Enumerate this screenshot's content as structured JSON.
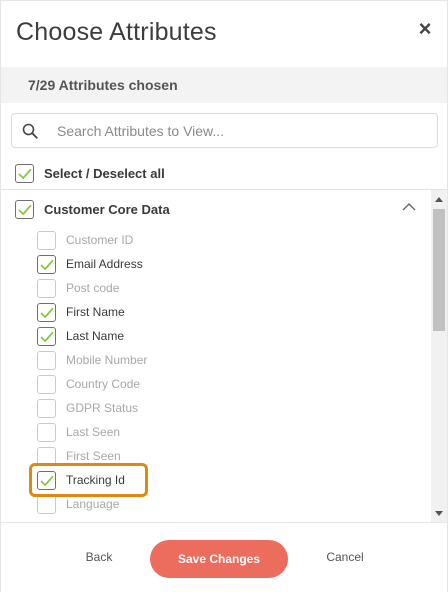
{
  "header": {
    "title": "Choose Attributes",
    "close_symbol": "×"
  },
  "summary": {
    "chosen_text": "7/29 Attributes chosen"
  },
  "search": {
    "placeholder": "Search Attributes to View...",
    "value": ""
  },
  "select_all": {
    "label": "Select / Deselect all",
    "checked": true
  },
  "groups": [
    {
      "label": "Customer Core Data",
      "checked": true,
      "expanded": true,
      "attributes": [
        {
          "label": "Customer ID",
          "checked": false
        },
        {
          "label": "Email Address",
          "checked": true
        },
        {
          "label": "Post code",
          "checked": false
        },
        {
          "label": "First Name",
          "checked": true
        },
        {
          "label": "Last Name",
          "checked": true
        },
        {
          "label": "Mobile Number",
          "checked": false
        },
        {
          "label": "Country Code",
          "checked": false
        },
        {
          "label": "GDPR Status",
          "checked": false
        },
        {
          "label": "Last Seen",
          "checked": false
        },
        {
          "label": "First Seen",
          "checked": false
        },
        {
          "label": "Tracking Id",
          "checked": true
        },
        {
          "label": "Language",
          "checked": false
        }
      ]
    }
  ],
  "footer": {
    "back_label": "Back",
    "save_label": "Save Changes",
    "cancel_label": "Cancel"
  },
  "colors": {
    "check": "#8cc63f",
    "save_button": "#ec6c5d",
    "highlight": "#dd8a12"
  },
  "icons": {
    "search": "search-icon",
    "close": "close-icon",
    "collapse": "chevron-up-icon",
    "check": "checkmark-icon"
  }
}
